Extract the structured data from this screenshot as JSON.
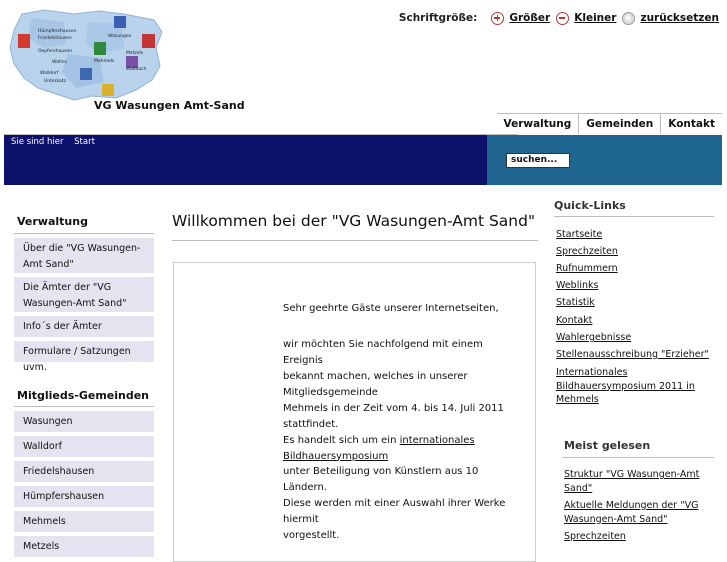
{
  "header": {
    "site_title": "VG Wasungen Amt-Sand",
    "map_labels": [
      "Hümpfershausen",
      "Friedelshausen",
      "Oepfershausen",
      "Wasungen",
      "Walldorf",
      "Metzels",
      "Mehmels",
      "Wahns",
      "Unterkatz",
      "Wallbach"
    ]
  },
  "fontsize": {
    "label": "Schriftgröße:",
    "bigger": "Größer",
    "smaller": "Kleiner",
    "reset": "zurücksetzen"
  },
  "tabs": [
    "Verwaltung",
    "Gemeinden",
    "Kontakt"
  ],
  "breadcrumb": {
    "prefix": "Sie sind hier",
    "current": "Start"
  },
  "search": {
    "placeholder": "suchen..."
  },
  "sidebar": {
    "verwaltung_title": "Verwaltung",
    "verwaltung_items": [
      "Über die \"VG Wasungen-Amt Sand\"",
      "Die Ämter der \"VG Wasungen-Amt Sand\"",
      "Info´s der Ämter",
      "Formulare / Satzungen uvm."
    ],
    "gemeinden_title": "Mitglieds-Gemeinden",
    "gemeinden_items": [
      "Wasungen",
      "Walldorf",
      "Friedelshausen",
      "Hümpfershausen",
      "Mehmels",
      "Metzels"
    ]
  },
  "main": {
    "title": "Willkommen bei der \"VG Wasungen-Amt Sand\"",
    "p1": "Sehr geehrte Gäste unserer Internetseiten,",
    "p2": "wir möchten Sie nachfolgend mit einem Ereignis",
    "p3": "bekannt machen, welches in unserer Mitgliedsgemeinde",
    "p4": "Mehmels in der Zeit vom 4. bis 14. Juli 2011 stattfindet.",
    "p5_prefix": "Es handelt sich um ein ",
    "p5_link": "internationales Bildhauersymposium",
    "p6": "unter Beteiligung von Künstlern aus 10 Ländern.",
    "p7": "Diese werden mit einer Auswahl ihrer Werke hiermit",
    "p8": "vorgestellt."
  },
  "quicklinks": {
    "title": "Quick-Links",
    "items": [
      "Startseite",
      "Sprechzeiten",
      "Rufnummern",
      "Weblinks",
      "Statistik",
      "Kontakt",
      "Wahlergebnisse",
      "Stellenausschreibung \"Erzieher\"",
      "Internationales Bildhauersymposium 2011 in Mehmels"
    ]
  },
  "meistgelesen": {
    "title": "Meist gelesen",
    "items": [
      "Struktur \"VG Wasungen-Amt Sand\"",
      "Aktuelle Meldungen der \"VG Wasungen-Amt Sand\"",
      "Sprechzeiten"
    ]
  },
  "colors": {
    "bluebar": "#0c116b",
    "bluebar_right": "#1e6690",
    "sidebar_item_bg": "#e3e4ef",
    "accent_red": "#b23a3a"
  }
}
